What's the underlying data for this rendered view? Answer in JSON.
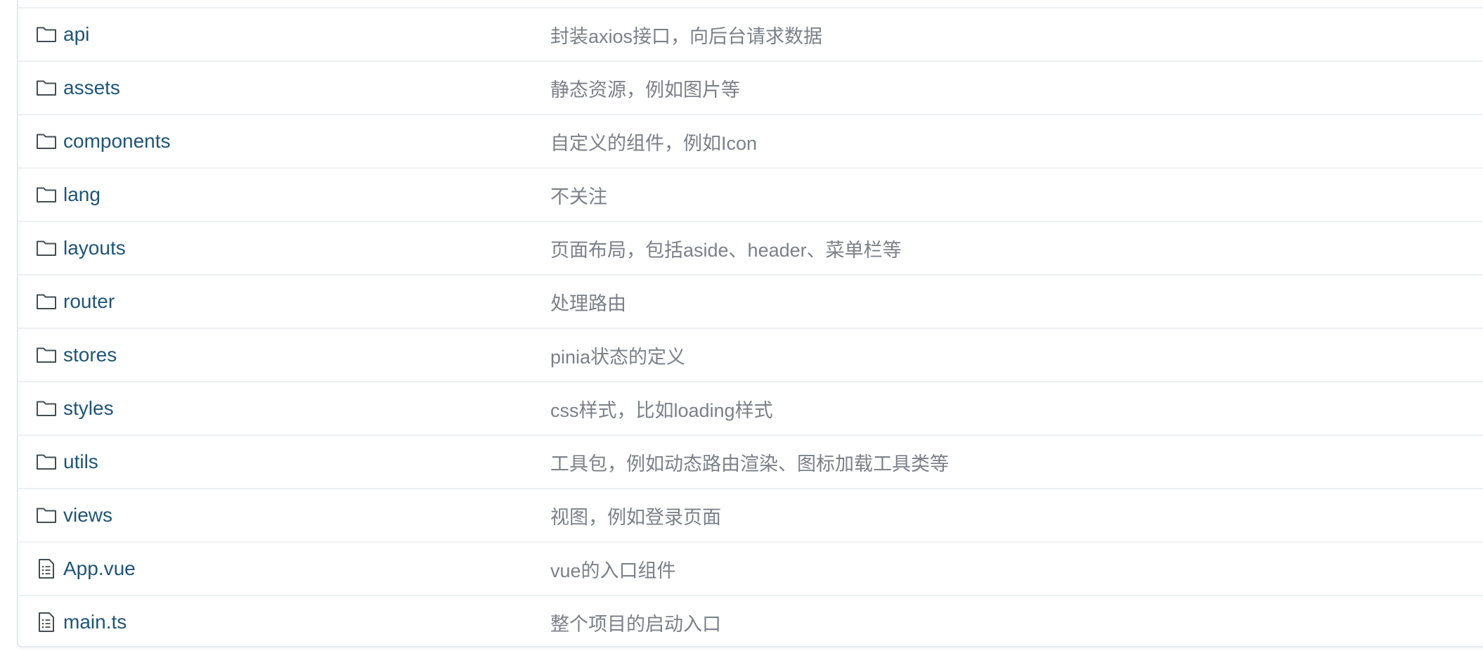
{
  "files": [
    {
      "name": "api",
      "type": "folder",
      "icon": "folder-icon",
      "desc": "封装axios接口，向后台请求数据"
    },
    {
      "name": "assets",
      "type": "folder",
      "icon": "folder-icon",
      "desc": "静态资源，例如图片等"
    },
    {
      "name": "components",
      "type": "folder",
      "icon": "folder-icon",
      "desc": "自定义的组件，例如Icon"
    },
    {
      "name": "lang",
      "type": "folder",
      "icon": "folder-icon",
      "desc": "不关注"
    },
    {
      "name": "layouts",
      "type": "folder",
      "icon": "folder-icon",
      "desc": "页面布局，包括aside、header、菜单栏等"
    },
    {
      "name": "router",
      "type": "folder",
      "icon": "folder-icon",
      "desc": "处理路由"
    },
    {
      "name": "stores",
      "type": "folder",
      "icon": "folder-icon",
      "desc": "pinia状态的定义"
    },
    {
      "name": "styles",
      "type": "folder",
      "icon": "folder-icon",
      "desc": "css样式，比如loading样式"
    },
    {
      "name": "utils",
      "type": "folder",
      "icon": "folder-icon",
      "desc": "工具包，例如动态路由渲染、图标加载工具类等"
    },
    {
      "name": "views",
      "type": "folder",
      "icon": "folder-icon",
      "desc": "视图，例如登录页面"
    },
    {
      "name": "App.vue",
      "type": "file",
      "icon": "file-text-icon",
      "desc": "vue的入口组件"
    },
    {
      "name": "main.ts",
      "type": "file",
      "icon": "file-text-icon",
      "desc": "整个项目的启动入口"
    }
  ],
  "colors": {
    "link": "#1e5577",
    "desc": "#7b8089",
    "border": "#eef1f4"
  }
}
